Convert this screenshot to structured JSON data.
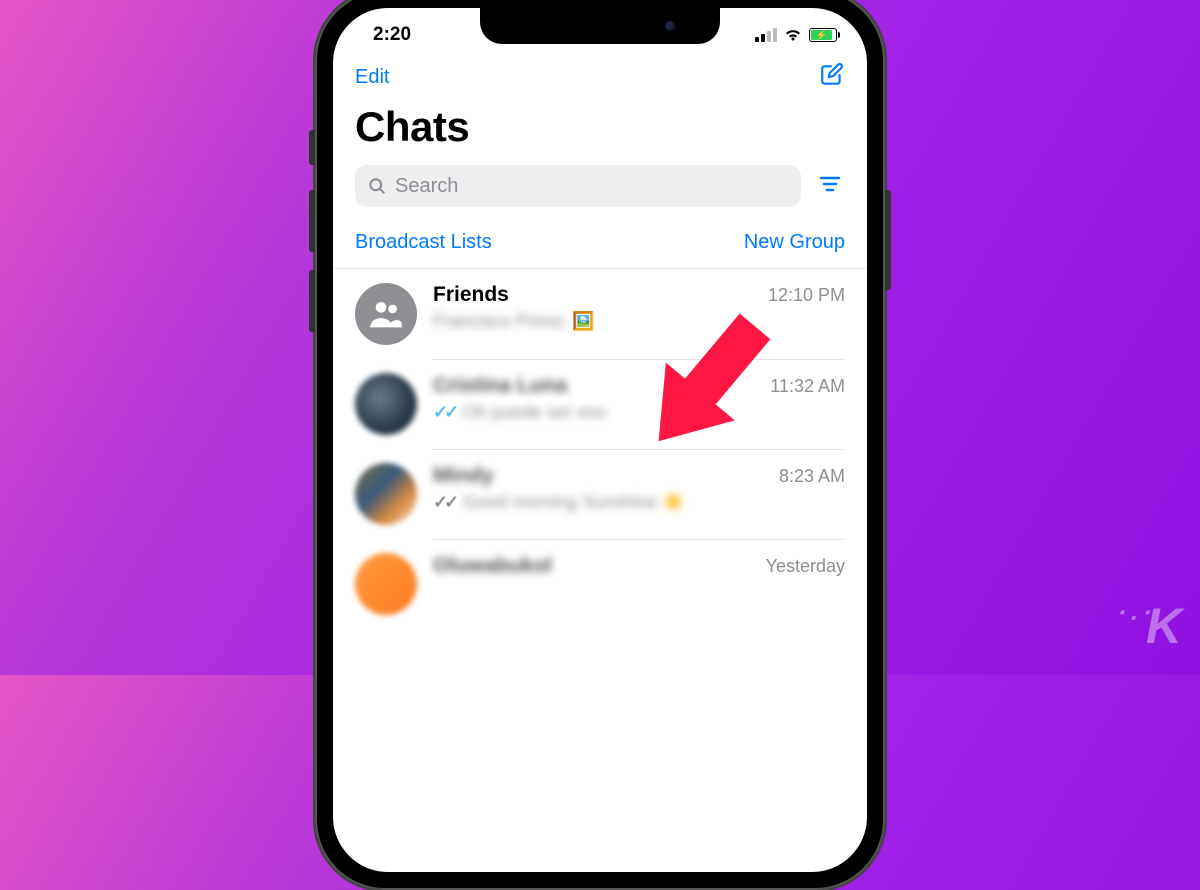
{
  "status": {
    "time": "2:20"
  },
  "nav": {
    "edit": "Edit"
  },
  "title": "Chats",
  "search": {
    "placeholder": "Search"
  },
  "links": {
    "broadcast": "Broadcast Lists",
    "newgroup": "New Group"
  },
  "chats": [
    {
      "name": "Friends",
      "time": "12:10 PM",
      "preview": "Francisco Primo:"
    },
    {
      "name": "Cristina Luna",
      "time": "11:32 AM",
      "preview": "Oh puede ser eso"
    },
    {
      "name": "Mindy",
      "time": "8:23 AM",
      "preview": "Good morning Sunshine ☀️"
    },
    {
      "name": "Oluwabukol",
      "time": "Yesterday",
      "preview": ""
    }
  ],
  "watermark": "K"
}
